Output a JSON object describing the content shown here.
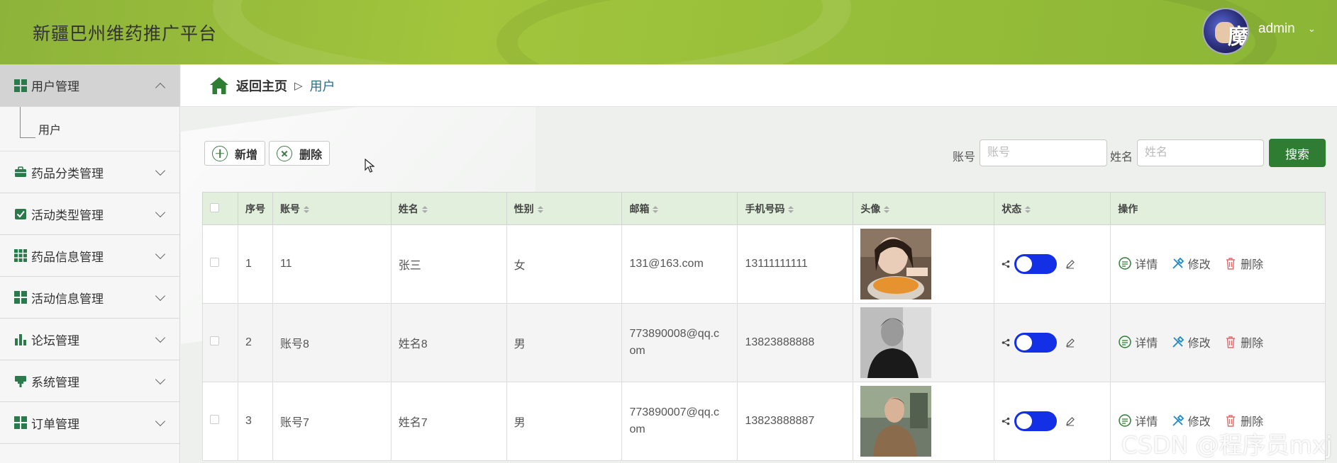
{
  "app": {
    "title": "新疆巴州维药推广平台",
    "user": "admin"
  },
  "sidebar": {
    "items": [
      {
        "label": "用户管理",
        "active": true,
        "sub": [
          "用户"
        ]
      },
      {
        "label": "药品分类管理"
      },
      {
        "label": "活动类型管理"
      },
      {
        "label": "药品信息管理"
      },
      {
        "label": "活动信息管理"
      },
      {
        "label": "论坛管理"
      },
      {
        "label": "系统管理"
      },
      {
        "label": "订单管理"
      }
    ]
  },
  "breadcrumb": {
    "home": "返回主页",
    "separator": "▷",
    "current": "用户"
  },
  "toolbar": {
    "add_label": "新增",
    "delete_label": "删除"
  },
  "search": {
    "account_label": "账号",
    "account_placeholder": "账号",
    "name_label": "姓名",
    "name_placeholder": "姓名",
    "button": "搜索"
  },
  "table": {
    "headers": [
      "序号",
      "账号",
      "姓名",
      "性别",
      "邮箱",
      "手机号码",
      "头像",
      "状态",
      "操作"
    ],
    "rows": [
      {
        "index": "1",
        "account": "11",
        "name": "张三",
        "gender": "女",
        "email": "131@163.com",
        "phone": "13111111111"
      },
      {
        "index": "2",
        "account": "账号8",
        "name": "姓名8",
        "gender": "男",
        "email": "773890008@qq.c\nom",
        "phone": "13823888888"
      },
      {
        "index": "3",
        "account": "账号7",
        "name": "姓名7",
        "gender": "男",
        "email": "773890007@qq.c\nom",
        "phone": "13823888887"
      }
    ],
    "actions": {
      "detail": "详情",
      "edit": "修改",
      "delete": "删除"
    }
  },
  "watermark": "CSDN @程序员mxj",
  "colors": {
    "header": "#a2c53c",
    "accent": "#2e7d32",
    "toggle": "#1430e6",
    "table_header": "#e1efdc"
  }
}
